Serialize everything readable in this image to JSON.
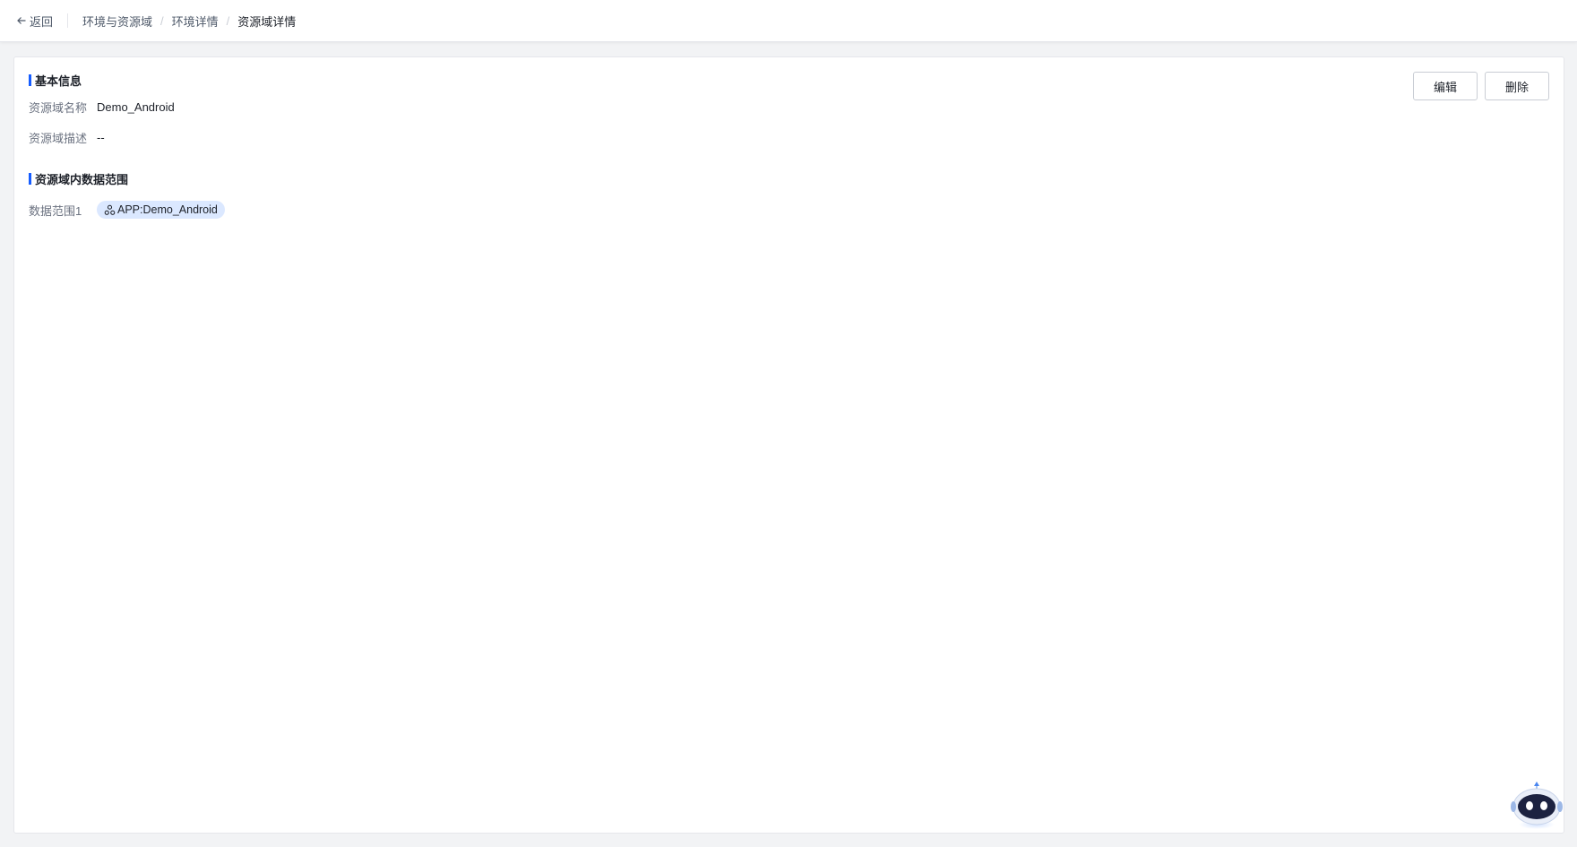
{
  "header": {
    "back_label": "返回",
    "breadcrumb": [
      "环境与资源域",
      "环境详情",
      "资源域详情"
    ]
  },
  "actions": {
    "edit_label": "编辑",
    "delete_label": "删除"
  },
  "basic_info": {
    "title": "基本信息",
    "name_label": "资源域名称",
    "name_value": "Demo_Android",
    "desc_label": "资源域描述",
    "desc_value": "--"
  },
  "data_scope": {
    "title": "资源域内数据范围",
    "item_label": "数据范围1",
    "item_tag": "APP:Demo_Android",
    "tag_icon": "app-cluster-icon"
  },
  "assistant": {
    "icon": "robot-assistant-icon"
  },
  "colors": {
    "accent": "#165dff",
    "tag_bg": "#dbe8ff",
    "page_bg": "#f2f3f5"
  }
}
